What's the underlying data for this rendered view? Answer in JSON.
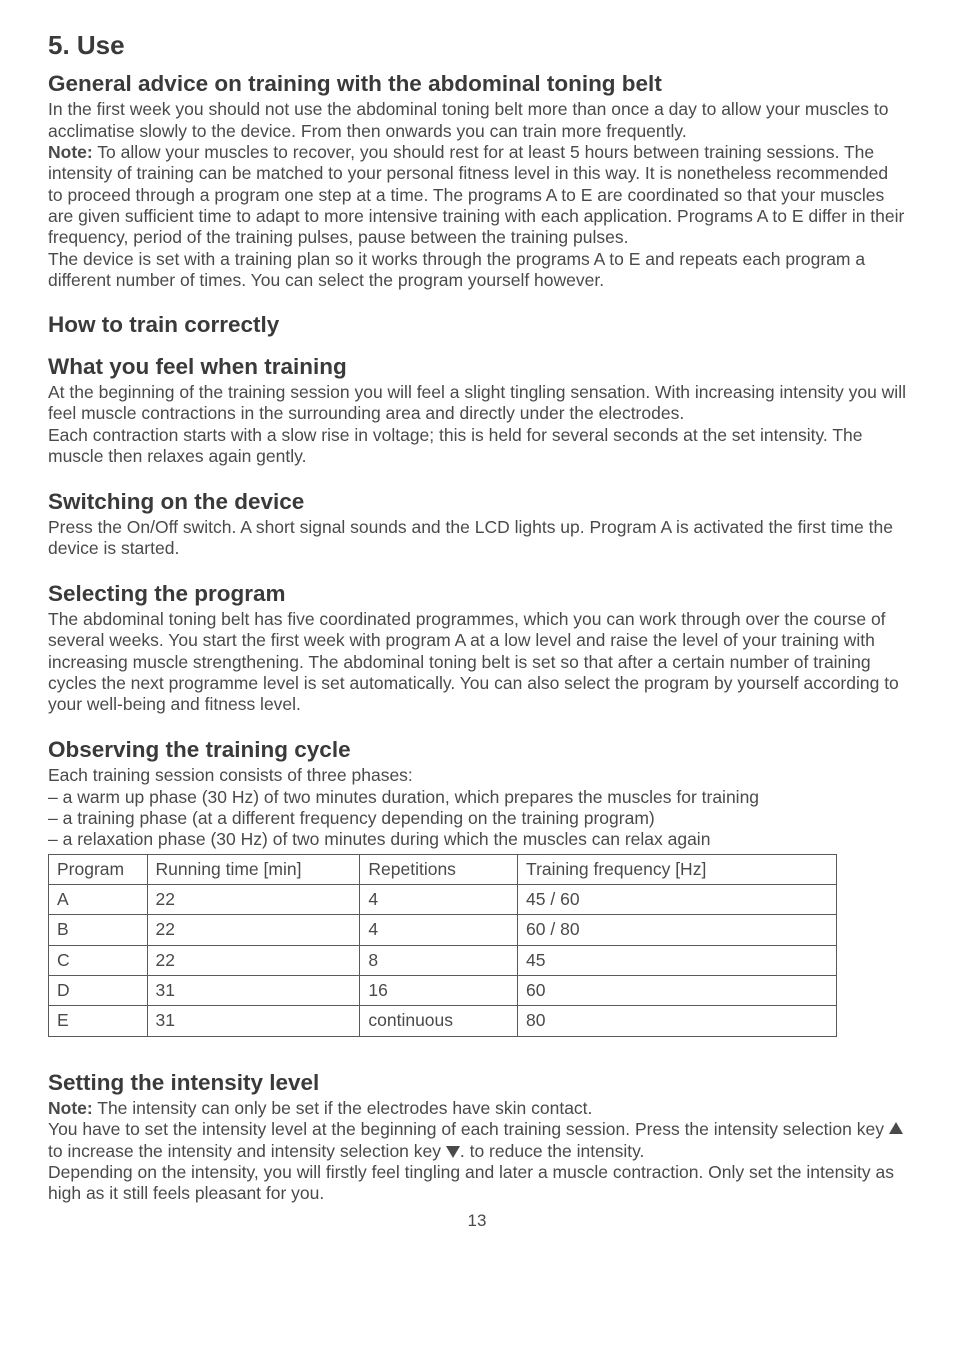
{
  "h1": "5. Use",
  "s1": {
    "h": "General advice on training with the abdominal toning belt",
    "p1": "In the first week you should not use the abdominal toning belt more than once a day to allow your muscles to acclimatise slowly to the device. From then onwards you can train more frequently.",
    "nlabel": "Note:",
    "p2": " To allow your muscles to recover, you should rest for at least 5 hours between training sessions. The intensity of training can be matched to your personal fitness level in this way. It is nonetheless recommended to proceed through a program one step at a time. The programs A to E are coordinated so that your muscles are given sufficient time to adapt to more intensive training with each application. Programs A to E differ in their frequency, period of the training pulses, pause between the training pulses.",
    "p3": "The device is set with a training plan so it works through the programs A to E and repeats each program a different number of times. You can select the program yourself however."
  },
  "s2": {
    "h": "How to train correctly"
  },
  "s3": {
    "h": "What you feel when training",
    "p1": "At the beginning of the training session you will feel a slight tingling sensation. With increasing intensity you will feel muscle contractions in the surrounding area and directly under the electrodes.",
    "p2": "Each contraction starts with a slow rise in voltage; this is held for several seconds at the set intensity. The muscle then relaxes again gently."
  },
  "s4": {
    "h": "Switching on the device",
    "p": "Press the On/Off switch. A short signal sounds and the LCD lights up. Program A is activated the first time the device is started."
  },
  "s5": {
    "h": "Selecting the program",
    "p": "The abdominal toning belt has five coordinated programmes, which you can work through over the course of several weeks. You start the first week with program A at a low level and raise the level of your training with increasing muscle strengthening. The abdominal toning belt is set so that after a certain number of training cycles the next programme level is set automatically. You can also select the program by yourself according to your well-being and fitness level."
  },
  "s6": {
    "h": "Observing the training cycle",
    "p1": "Each training session consists of three phases:",
    "b1": "– a warm up phase (30 Hz) of two minutes duration, which prepares the muscles for training",
    "b2": "– a training phase (at a different frequency depending on the training program)",
    "b3": "– a relaxation phase (30 Hz) of two minutes during which the muscles can relax again"
  },
  "table": {
    "h0": "Program",
    "h1": "Running time [min]",
    "h2": "Repetitions",
    "h3": "Training frequency [Hz]",
    "r0": {
      "c0": "A",
      "c1": "22",
      "c2": "4",
      "c3": "45 / 60"
    },
    "r1": {
      "c0": "B",
      "c1": "22",
      "c2": "4",
      "c3": "60 / 80"
    },
    "r2": {
      "c0": "C",
      "c1": "22",
      "c2": "8",
      "c3": "45"
    },
    "r3": {
      "c0": "D",
      "c1": "31",
      "c2": "16",
      "c3": "60"
    },
    "r4": {
      "c0": "E",
      "c1": "31",
      "c2": "continuous",
      "c3": "80"
    }
  },
  "s7": {
    "h": "Setting the intensity level",
    "nlabel": "Note:",
    "p1": " The intensity can only be set if the electrodes have skin contact.",
    "p2a": "You have to set the intensity level at the beginning of each training session. Press the intensity selection key ",
    "p2b": " to increase the intensity and intensity selection key ",
    "p2c": ". to reduce the intensity.",
    "p3": "Depending on the intensity, you will firstly feel tingling and later a muscle contraction. Only set the intensity as high as it still feels pleasant for you."
  },
  "page": "13"
}
